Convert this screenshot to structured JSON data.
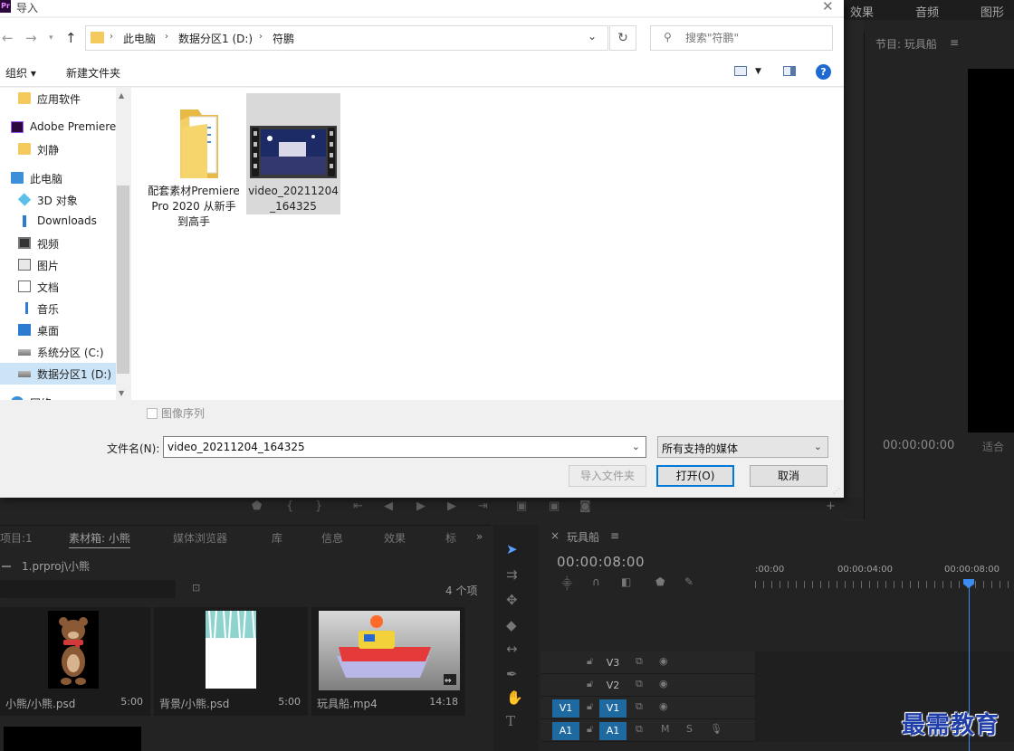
{
  "premiere": {
    "top_tabs": [
      "效果",
      "音频",
      "图形"
    ],
    "program": {
      "title": "节目: 玩具船",
      "timecode": "00:00:00:00",
      "fit": "适合"
    },
    "project": {
      "tabs": [
        "项目:1",
        "素材箱: 小熊",
        "媒体浏览器",
        "库",
        "信息",
        "效果",
        "标"
      ],
      "path": "1.prproj\\小熊",
      "item_count": "4 个项",
      "clips": [
        {
          "name": "小熊/小熊.psd",
          "duration": "5:00"
        },
        {
          "name": "背景/小熊.psd",
          "duration": "5:00"
        },
        {
          "name": "玩具船.mp4",
          "duration": "14:18"
        }
      ]
    },
    "timeline": {
      "title": "玩具船",
      "timecode": "00:00:08:00",
      "ruler": [
        ":00:00",
        "00:00:04:00",
        "00:00:08:00"
      ],
      "tracks": [
        {
          "label": "V3",
          "source": ""
        },
        {
          "label": "V2",
          "source": ""
        },
        {
          "label": "V1",
          "source": "V1"
        },
        {
          "label": "A1",
          "source": "A1",
          "m": "M",
          "s": "S"
        }
      ]
    },
    "watermark": "最需教育"
  },
  "dialog": {
    "app_badge": "Pr",
    "title": "导入",
    "breadcrumb": [
      "此电脑",
      "数据分区1 (D:)",
      "符鹏"
    ],
    "search_placeholder": "搜索\"符鹏\"",
    "toolbar": {
      "organize": "组织 ▾",
      "new_folder": "新建文件夹"
    },
    "sidebar": [
      {
        "label": "应用软件",
        "icon": "folder-icon",
        "indent": 1
      },
      {
        "label": "Adobe Premiere",
        "icon": "premiere-icon",
        "indent": 0
      },
      {
        "label": "刘静",
        "icon": "folder-icon",
        "indent": 1
      },
      {
        "label": "此电脑",
        "icon": "computer-icon",
        "indent": 0
      },
      {
        "label": "3D 对象",
        "icon": "cube-icon",
        "indent": 1
      },
      {
        "label": "Downloads",
        "icon": "download-icon",
        "indent": 1
      },
      {
        "label": "视频",
        "icon": "video-icon",
        "indent": 1
      },
      {
        "label": "图片",
        "icon": "picture-icon",
        "indent": 1
      },
      {
        "label": "文档",
        "icon": "document-icon",
        "indent": 1
      },
      {
        "label": "音乐",
        "icon": "music-icon",
        "indent": 1
      },
      {
        "label": "桌面",
        "icon": "desktop-icon",
        "indent": 1
      },
      {
        "label": "系统分区 (C:)",
        "icon": "drive-icon",
        "indent": 1
      },
      {
        "label": "数据分区1 (D:)",
        "icon": "drive-icon",
        "indent": 1,
        "selected": true
      },
      {
        "label": "网络",
        "icon": "network-icon",
        "indent": 0
      }
    ],
    "files": [
      {
        "name": "配套素材Premiere Pro 2020 从新手到高手",
        "type": "folder"
      },
      {
        "name": "video_20211204_164325",
        "type": "video",
        "selected": true
      }
    ],
    "image_sequence_label": "图像序列",
    "filename_label": "文件名(N):",
    "filename_value": "video_20211204_164325",
    "filetype_value": "所有支持的媒体",
    "buttons": {
      "import_folder": "导入文件夹",
      "open": "打开(O)",
      "cancel": "取消"
    }
  }
}
